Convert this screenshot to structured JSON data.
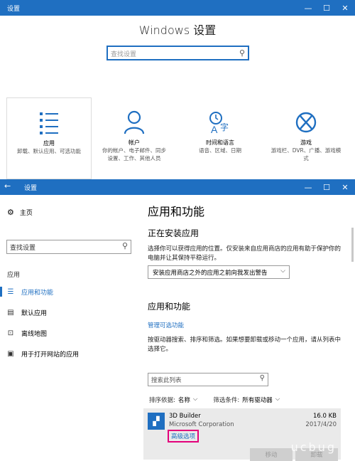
{
  "window1": {
    "title": "设置",
    "minimize": "—",
    "maximize": "☐",
    "close": "✕",
    "heading": "Windows 设置",
    "search_placeholder": "查找设置",
    "categories": [
      {
        "name": "应用",
        "desc": "卸载、默认应用、可选功能",
        "icon": "apps-list-icon"
      },
      {
        "name": "帐户",
        "desc": "你的帐户、电子邮件、同步设置、工作、其他人员",
        "icon": "person-icon"
      },
      {
        "name": "时间和语言",
        "desc": "语音、区域、日期",
        "icon": "time-language-icon"
      },
      {
        "name": "游戏",
        "desc": "游戏栏、DVR、广播、游戏模式",
        "icon": "xbox-icon"
      }
    ]
  },
  "window2": {
    "title": "设置",
    "back": "←",
    "minimize": "—",
    "maximize": "☐",
    "close": "✕",
    "sidebar": {
      "home": "主页",
      "search_placeholder": "查找设置",
      "section": "应用",
      "items": [
        {
          "label": "应用和功能",
          "icon": "list-icon"
        },
        {
          "label": "默认应用",
          "icon": "default-apps-icon"
        },
        {
          "label": "离线地图",
          "icon": "map-icon"
        },
        {
          "label": "用于打开网站的应用",
          "icon": "web-apps-icon"
        }
      ]
    },
    "main": {
      "title": "应用和功能",
      "install_heading": "正在安装应用",
      "install_desc": "选择你可以获得应用的位置。仅安装来自应用商店的应用有助于保护你的电脑并让其保持平稳运行。",
      "install_option": "安装应用商店之外的应用之前向我发出警告",
      "apps_heading": "应用和功能",
      "manage_link": "管理可选功能",
      "apps_desc": "按驱动器搜索、排序和筛选。如果想要卸载或移动一个应用，请从列表中选择它。",
      "search_placeholder": "搜索此列表",
      "sort_label": "排序依据:",
      "sort_value": "名称",
      "filter_label": "筛选条件:",
      "filter_value": "所有驱动器",
      "app": {
        "name": "3D Builder",
        "publisher": "Microsoft Corporation",
        "size": "16.0 KB",
        "date": "2017/4/20",
        "advanced": "高级选项",
        "move": "移动",
        "uninstall": "卸载"
      },
      "watermark": "ucbug"
    }
  }
}
